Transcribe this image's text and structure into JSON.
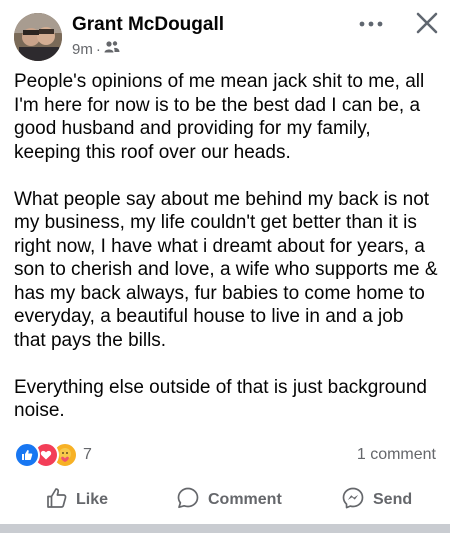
{
  "post": {
    "author": "Grant McDougall",
    "time": "9m",
    "separator": "·",
    "audience_icon": "friends-icon",
    "paragraphs": [
      "People's opinions of me mean jack shit to me, all I'm here for now is to be the best dad I can be, a good husband and providing for my family, keeping this roof over our heads.",
      "What people say about me behind my back is not my business, my life couldn't get better than it is right now, I have what i dreamt about for years, a son to cherish and love, a wife who supports me & has my back always, fur babies to come home to everyday, a beautiful house to live in and a job that pays the bills.",
      "Everything else outside of that is just background noise."
    ]
  },
  "stats": {
    "reaction_icons": [
      "like-icon",
      "love-icon",
      "care-icon"
    ],
    "reaction_count": "7",
    "comment_count": "1 comment"
  },
  "actions": {
    "like": "Like",
    "comment": "Comment",
    "send": "Send"
  },
  "colors": {
    "like": "#1877f2",
    "love": "#f33e58",
    "care": "#f7b125",
    "secondary_text": "#65676b"
  }
}
